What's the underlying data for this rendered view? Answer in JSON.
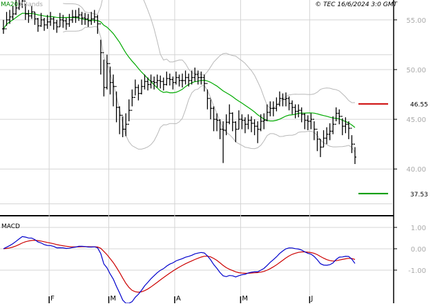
{
  "header": {
    "legend_ma": "MA20",
    "legend_bb": "BBands",
    "copyright": "© TEC 16/6/2024 3:0 GMT"
  },
  "colors": {
    "ma": "#00aa00",
    "bbands": "#b8b8b8",
    "bars": "#000000",
    "macd_line": "#0000cc",
    "signal_line": "#cc0000",
    "resistance": "#cc0000",
    "support": "#009900",
    "grid": "#d4d4d4"
  },
  "chart_data": [
    {
      "type": "ohlc",
      "title": "",
      "x_ticks": [
        "F",
        "M",
        "A",
        "M",
        "J"
      ],
      "y_ticks": [
        "55.00",
        "50.00",
        "45.00",
        "40.00"
      ],
      "ylim": [
        35.3,
        57.0
      ],
      "levels": [
        {
          "name": "resistance",
          "value": 46.55,
          "label": "46.55"
        },
        {
          "name": "support",
          "value": 37.53,
          "label": "37.53"
        }
      ],
      "close": [
        54.1,
        55.0,
        55.3,
        55.6,
        56.2,
        56.6,
        56.9,
        55.6,
        55.4,
        55.8,
        55.1,
        54.4,
        55.0,
        54.5,
        54.8,
        55.1,
        54.7,
        54.3,
        55.0,
        54.9,
        54.6,
        55.0,
        55.3,
        55.3,
        55.5,
        55.2,
        55.1,
        54.9,
        55.1,
        55.3,
        54.6,
        51.7,
        48.2,
        50.6,
        48.7,
        48.3,
        46.2,
        45.4,
        44.0,
        44.5,
        45.9,
        47.2,
        48.2,
        47.6,
        48.3,
        48.8,
        48.5,
        48.8,
        48.7,
        48.9,
        48.8,
        48.5,
        49.1,
        49.0,
        48.7,
        49.2,
        48.9,
        48.9,
        49.2,
        48.9,
        49.2,
        49.5,
        49.2,
        49.2,
        48.6,
        47.1,
        46.1,
        45.0,
        44.9,
        44.0,
        43.9,
        44.7,
        45.6,
        44.7,
        44.0,
        45.0,
        44.9,
        44.5,
        44.9,
        44.6,
        44.3,
        44.0,
        44.8,
        44.9,
        45.7,
        46.1,
        46.1,
        46.5,
        47.1,
        47.0,
        47.1,
        46.6,
        46.2,
        45.8,
        45.9,
        45.5,
        44.9,
        44.8,
        45.0,
        44.0,
        43.0,
        42.2,
        43.1,
        43.5,
        43.8,
        44.5,
        45.6,
        45.3,
        44.3,
        44.5,
        44.1,
        42.5,
        41.2
      ],
      "high": [
        55.0,
        55.8,
        56.0,
        56.4,
        57.0,
        57.2,
        57.8,
        56.6,
        56.0,
        56.4,
        55.8,
        55.2,
        55.7,
        55.2,
        55.5,
        55.8,
        55.3,
        55.0,
        55.7,
        55.5,
        55.2,
        55.6,
        56.0,
        56.0,
        56.2,
        55.8,
        55.7,
        55.6,
        55.8,
        56.0,
        55.5,
        53.0,
        51.0,
        51.5,
        50.3,
        49.5,
        47.8,
        46.3,
        45.3,
        45.6,
        47.0,
        48.0,
        49.0,
        48.5,
        49.0,
        49.5,
        49.2,
        49.5,
        49.3,
        49.5,
        49.4,
        49.2,
        49.8,
        49.6,
        49.3,
        49.8,
        49.5,
        49.6,
        49.9,
        49.6,
        49.9,
        50.2,
        49.9,
        49.8,
        49.5,
        48.0,
        47.0,
        46.3,
        45.6,
        45.0,
        44.8,
        45.5,
        46.5,
        45.7,
        44.8,
        45.9,
        45.5,
        45.2,
        45.5,
        45.3,
        45.0,
        44.8,
        45.5,
        45.6,
        46.5,
        46.8,
        46.8,
        47.2,
        47.8,
        47.6,
        47.7,
        47.3,
        46.9,
        46.5,
        46.5,
        46.2,
        45.6,
        45.4,
        45.6,
        44.8,
        43.8,
        43.0,
        43.9,
        44.2,
        44.6,
        45.3,
        46.2,
        46.0,
        45.1,
        45.2,
        44.8,
        43.4,
        42.2
      ],
      "low": [
        53.6,
        54.4,
        54.6,
        55.0,
        55.5,
        56.0,
        56.2,
        55.0,
        54.7,
        55.1,
        54.5,
        53.8,
        54.3,
        53.9,
        54.1,
        54.4,
        54.0,
        53.7,
        54.3,
        54.2,
        54.0,
        54.3,
        54.7,
        54.7,
        54.9,
        54.5,
        54.5,
        54.3,
        54.5,
        54.7,
        53.6,
        49.5,
        47.3,
        48.0,
        47.5,
        46.3,
        44.7,
        43.5,
        43.2,
        43.3,
        44.8,
        46.3,
        47.4,
        46.9,
        47.5,
        48.0,
        47.9,
        48.1,
        48.0,
        48.2,
        48.1,
        47.9,
        48.4,
        48.4,
        48.0,
        48.5,
        48.3,
        48.2,
        48.5,
        48.3,
        48.5,
        48.8,
        48.5,
        48.5,
        47.8,
        46.0,
        45.0,
        43.8,
        43.8,
        43.0,
        40.6,
        43.4,
        44.5,
        43.8,
        42.7,
        44.0,
        44.0,
        43.6,
        44.0,
        43.7,
        43.4,
        42.6,
        43.8,
        44.0,
        44.8,
        45.3,
        45.3,
        45.8,
        46.3,
        46.3,
        46.3,
        45.9,
        45.5,
        45.1,
        45.2,
        44.7,
        44.0,
        43.9,
        44.0,
        42.9,
        41.8,
        41.2,
        42.2,
        42.5,
        42.9,
        43.5,
        44.8,
        44.5,
        43.4,
        43.6,
        43.0,
        41.6,
        40.5
      ]
    },
    {
      "type": "line",
      "title": "MACD",
      "y_ticks": [
        "1.00",
        "0.00",
        "-1.00"
      ],
      "ylim": [
        -2.55,
        1.45
      ]
    }
  ]
}
